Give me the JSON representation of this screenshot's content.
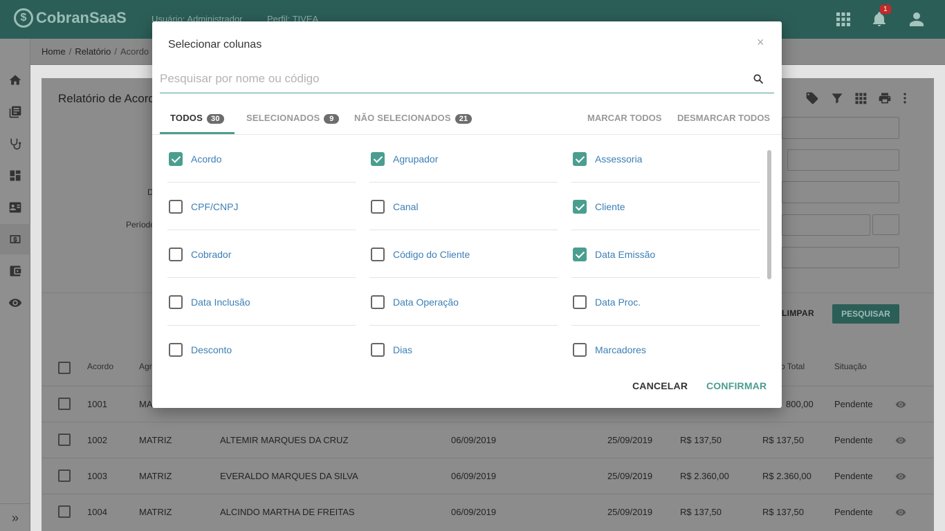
{
  "colors": {
    "accent": "#4a9e8f",
    "topbar": "#2c5e58",
    "link": "#3b7fb6"
  },
  "header": {
    "logo_symbol": "$",
    "logo_text": "CobranSaaS",
    "user_text": "Usuário: Administrador",
    "profile_text": "Perfil: TIVEA",
    "notification_count": "1"
  },
  "breadcrumb": [
    "Home",
    "Relatório",
    "Acordo"
  ],
  "page": {
    "title": "Relatório de Acordo",
    "label_d": "D",
    "label_periodo": "Período",
    "limpar_label": "LIMPAR",
    "pesquisar_label": "PESQUISAR"
  },
  "table": {
    "headers": [
      "Acordo",
      "Agr",
      "o Total",
      "Situação"
    ],
    "rows": [
      {
        "acordo": "1001",
        "agrupador": "MA",
        "cliente": "",
        "data_emissao": "",
        "data_venc": "",
        "valor": "",
        "total": "800,00",
        "situacao": "Pendente"
      },
      {
        "acordo": "1002",
        "agrupador": "MATRIZ",
        "cliente": "ALTEMIR MARQUES DA CRUZ",
        "data_emissao": "06/09/2019",
        "data_venc": "25/09/2019",
        "valor": "R$ 137,50",
        "total": "R$ 137,50",
        "situacao": "Pendente"
      },
      {
        "acordo": "1003",
        "agrupador": "MATRIZ",
        "cliente": "EVERALDO MARQUES DA SILVA",
        "data_emissao": "06/09/2019",
        "data_venc": "25/09/2019",
        "valor": "R$ 2.360,00",
        "total": "R$ 2.360,00",
        "situacao": "Pendente"
      },
      {
        "acordo": "1004",
        "agrupador": "MATRIZ",
        "cliente": "ALCINDO MARTHA DE FREITAS",
        "data_emissao": "06/09/2019",
        "data_venc": "25/09/2019",
        "valor": "R$ 137,50",
        "total": "R$ 137,50",
        "situacao": "Pendente"
      }
    ]
  },
  "modal": {
    "title": "Selecionar colunas",
    "close_symbol": "×",
    "search": {
      "placeholder": "Pesquisar por nome ou código",
      "value": ""
    },
    "tabs": [
      {
        "label": "TODOS",
        "count": "30"
      },
      {
        "label": "SELECIONADOS",
        "count": "9"
      },
      {
        "label": "NÃO SELECIONADOS",
        "count": "21"
      }
    ],
    "mark_all": "MARCAR TODOS",
    "unmark_all": "DESMARCAR TODOS",
    "options": [
      {
        "label": "Acordo",
        "checked": true
      },
      {
        "label": "Agrupador",
        "checked": true
      },
      {
        "label": "Assessoria",
        "checked": true
      },
      {
        "label": "CPF/CNPJ",
        "checked": false
      },
      {
        "label": "Canal",
        "checked": false
      },
      {
        "label": "Cliente",
        "checked": true
      },
      {
        "label": "Cobrador",
        "checked": false
      },
      {
        "label": "Código do Cliente",
        "checked": false
      },
      {
        "label": "Data Emissão",
        "checked": true
      },
      {
        "label": "Data Inclusão",
        "checked": false
      },
      {
        "label": "Data Operação",
        "checked": false
      },
      {
        "label": "Data Proc.",
        "checked": false
      },
      {
        "label": "Desconto",
        "checked": false
      },
      {
        "label": "Dias",
        "checked": false
      },
      {
        "label": "Marcadores",
        "checked": false
      }
    ],
    "cancel_label": "CANCELAR",
    "confirm_label": "CONFIRMAR"
  }
}
